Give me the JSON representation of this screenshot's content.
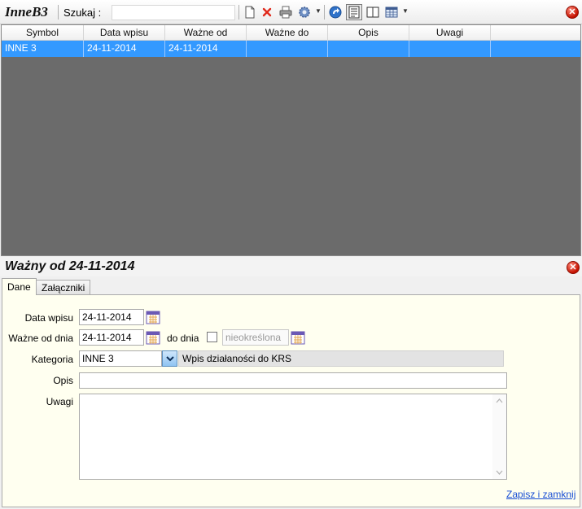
{
  "app": {
    "title": "InneB3",
    "search_label": "Szukaj  :",
    "search_value": ""
  },
  "toolbar": {
    "icons": [
      "new-document-icon",
      "delete-icon",
      "print-icon",
      "settings-icon",
      "refresh-icon",
      "form-view-icon",
      "split-view-icon",
      "grid-view-icon"
    ]
  },
  "grid": {
    "columns": [
      "Symbol",
      "Data wpisu",
      "Ważne od",
      "Ważne do",
      "Opis",
      "Uwagi"
    ],
    "rows": [
      {
        "symbol": "INNE 3",
        "data_wpisu": "24-11-2014",
        "wazne_od": "24-11-2014",
        "wazne_do": "",
        "opis": "",
        "uwagi": ""
      }
    ]
  },
  "detail": {
    "title": "Ważny od 24-11-2014",
    "tabs": [
      "Dane",
      "Załączniki"
    ],
    "labels": {
      "data_wpisu": "Data wpisu",
      "wazne_od_dnia": "Ważne od dnia",
      "do_dnia": "do dnia",
      "kategoria": "Kategoria",
      "opis": "Opis",
      "uwagi": "Uwagi"
    },
    "values": {
      "data_wpisu": "24-11-2014",
      "wazne_od_dnia": "24-11-2014",
      "do_dnia": "nieokreślona",
      "do_dnia_checked": false,
      "kategoria": "INNE 3",
      "kategoria_opis": "Wpis działaności do KRS",
      "opis": "",
      "uwagi": ""
    },
    "save_link": "Zapisz i zamknij"
  },
  "colors": {
    "selection": "#3399ff",
    "grid_bg": "#6b6b6b",
    "panel_bg": "#fffff0",
    "close": "#c41200",
    "link": "#1a4fd4"
  }
}
